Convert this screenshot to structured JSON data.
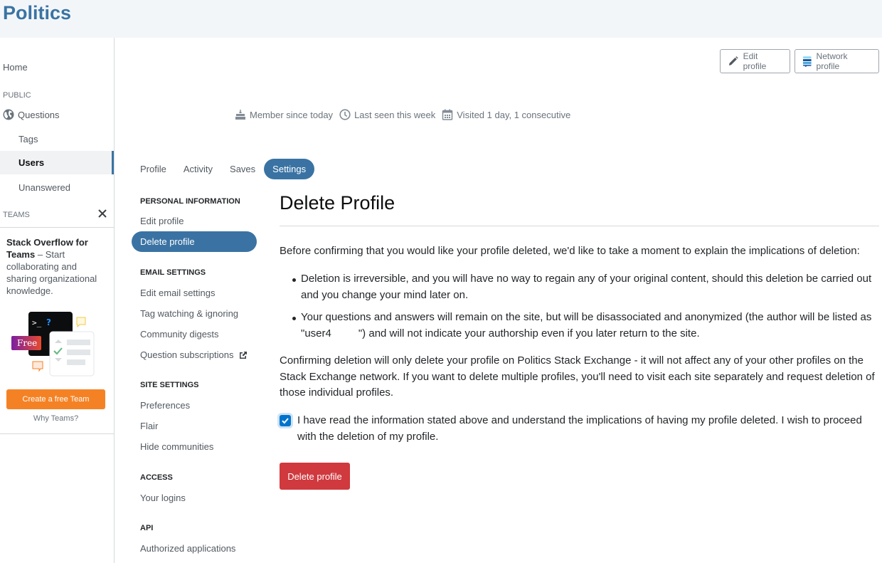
{
  "site": {
    "title": "Politics"
  },
  "left_nav": {
    "home": "Home",
    "public_label": "PUBLIC",
    "questions": "Questions",
    "tags": "Tags",
    "users": "Users",
    "unanswered": "Unanswered",
    "teams_label": "TEAMS",
    "teams_promo_bold": "Stack Overflow for Teams",
    "teams_promo_rest": " – Start collaborating and sharing organizational knowledge.",
    "free_badge": "Free",
    "terminal_prompt": ">_",
    "terminal_q": "?",
    "create_team_button": "Create a free Team",
    "why_teams": "Why Teams?"
  },
  "profile_actions": {
    "edit_profile": "Edit profile",
    "network_profile": "Network profile"
  },
  "profile_meta": {
    "member_since": "Member since today",
    "last_seen": "Last seen this week",
    "visited": "Visited 1 day, 1 consecutive"
  },
  "tabs": [
    {
      "label": "Profile",
      "active": false
    },
    {
      "label": "Activity",
      "active": false
    },
    {
      "label": "Saves",
      "active": false
    },
    {
      "label": "Settings",
      "active": true
    }
  ],
  "settings_nav": {
    "personal_information": "PERSONAL INFORMATION",
    "edit_profile": "Edit profile",
    "delete_profile": "Delete profile",
    "email_settings": "EMAIL SETTINGS",
    "edit_email_settings": "Edit email settings",
    "tag_watching": "Tag watching & ignoring",
    "community_digests": "Community digests",
    "question_subscriptions": "Question subscriptions",
    "site_settings": "SITE SETTINGS",
    "preferences": "Preferences",
    "flair": "Flair",
    "hide_communities": "Hide communities",
    "access": "ACCESS",
    "your_logins": "Your logins",
    "api": "API",
    "authorized_applications": "Authorized applications"
  },
  "content": {
    "heading": "Delete Profile",
    "intro": "Before confirming that you would like your profile deleted, we'd like to take a moment to explain the implications of deletion:",
    "bullet1": "Deletion is irreversible, and you will have no way to regain any of your original content, should this deletion be carried out and you change your mind later on.",
    "bullet2_a": "Your questions and answers will remain on the site, but will be disassociated and anonymized (the author will be listed as \"user4",
    "bullet2_b": "\") and will not indicate your authorship even if you later return to the site.",
    "confirm_para": "Confirming deletion will only delete your profile on Politics Stack Exchange - it will not affect any of your other profiles on the Stack Exchange network. If you want to delete multiple profiles, you'll need to visit each site separately and request deletion of those individual profiles.",
    "checkbox_checked": true,
    "checkbox_label": "I have read the information stated above and understand the implications of having my profile deleted. I wish to proceed with the deletion of my profile.",
    "delete_button": "Delete profile"
  },
  "colors": {
    "brand": "#3a73a3",
    "danger": "#d0393e",
    "cta_orange": "#f48225",
    "checkbox": "#0074cc"
  }
}
